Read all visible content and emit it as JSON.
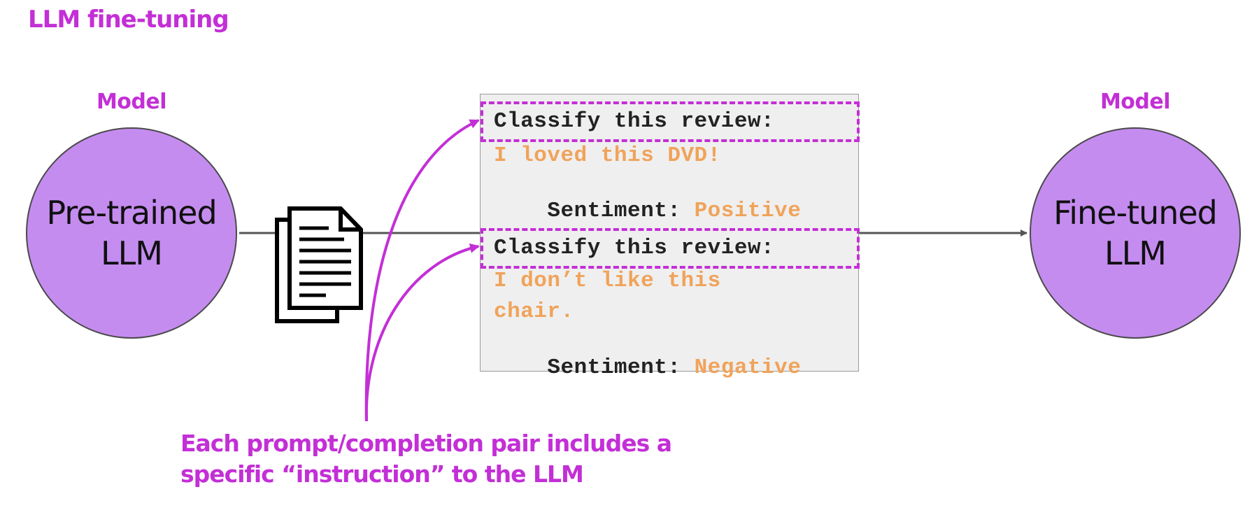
{
  "slide": {
    "title": "LLM fine-tuning"
  },
  "left_model": {
    "label": "Model",
    "name": "Pre-trained\nLLM"
  },
  "right_model": {
    "label": "Model",
    "name": "Fine-tuned\nLLM"
  },
  "examples": [
    {
      "instruction": "Classify this review:",
      "review_lines": [
        "I loved this DVD!"
      ],
      "sentiment_label": "Sentiment:",
      "sentiment_value": "Positive"
    },
    {
      "instruction": "Classify this review:",
      "review_lines": [
        "I don’t like this",
        "chair."
      ],
      "sentiment_label": "Sentiment:",
      "sentiment_value": "Negative"
    }
  ],
  "caption": {
    "line1": "Each prompt/completion pair includes a",
    "line2": "specific “instruction” to the LLM"
  },
  "icons": [
    "documents-icon"
  ],
  "colors": {
    "accent": "#c32fd6",
    "model_fill": "#c58cf0",
    "completion_text": "#f0a35a",
    "box_fill": "#efefef",
    "connector": "#555555"
  }
}
